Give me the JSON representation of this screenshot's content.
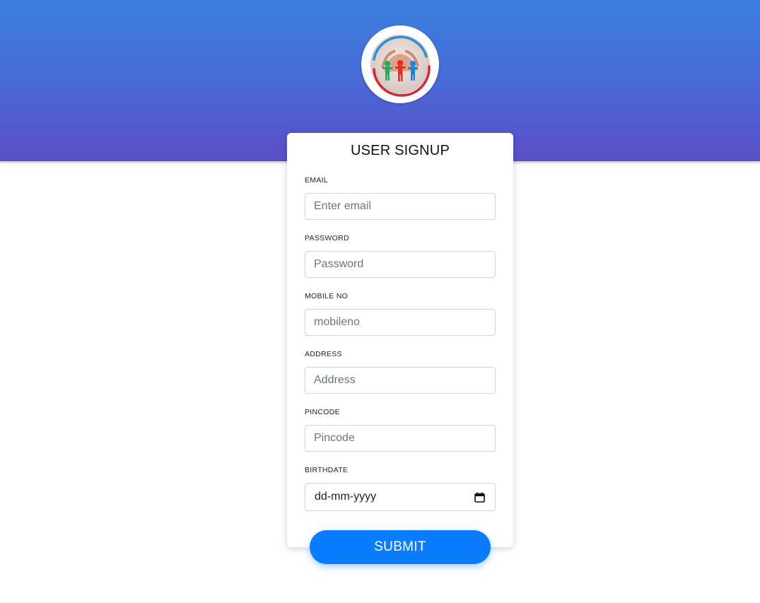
{
  "form": {
    "title": "USER SIGNUP",
    "fields": [
      {
        "label": "EMAIL",
        "placeholder": "Enter email"
      },
      {
        "label": "PASSWORD",
        "placeholder": "Password"
      },
      {
        "label": "MOBILE NO",
        "placeholder": "mobileno"
      },
      {
        "label": "ADDRESS",
        "placeholder": "Address"
      },
      {
        "label": "PINCODE",
        "placeholder": "Pincode"
      },
      {
        "label": "BIRTHDATE",
        "placeholder": "dd-mm-yyyy"
      }
    ],
    "submit_label": "SUBMIT"
  },
  "logo": {
    "icon": "people-hands-logo"
  },
  "colors": {
    "header_top": "#3a7fe0",
    "header_bottom": "#5a4ec6",
    "button": "#0a7cff"
  }
}
